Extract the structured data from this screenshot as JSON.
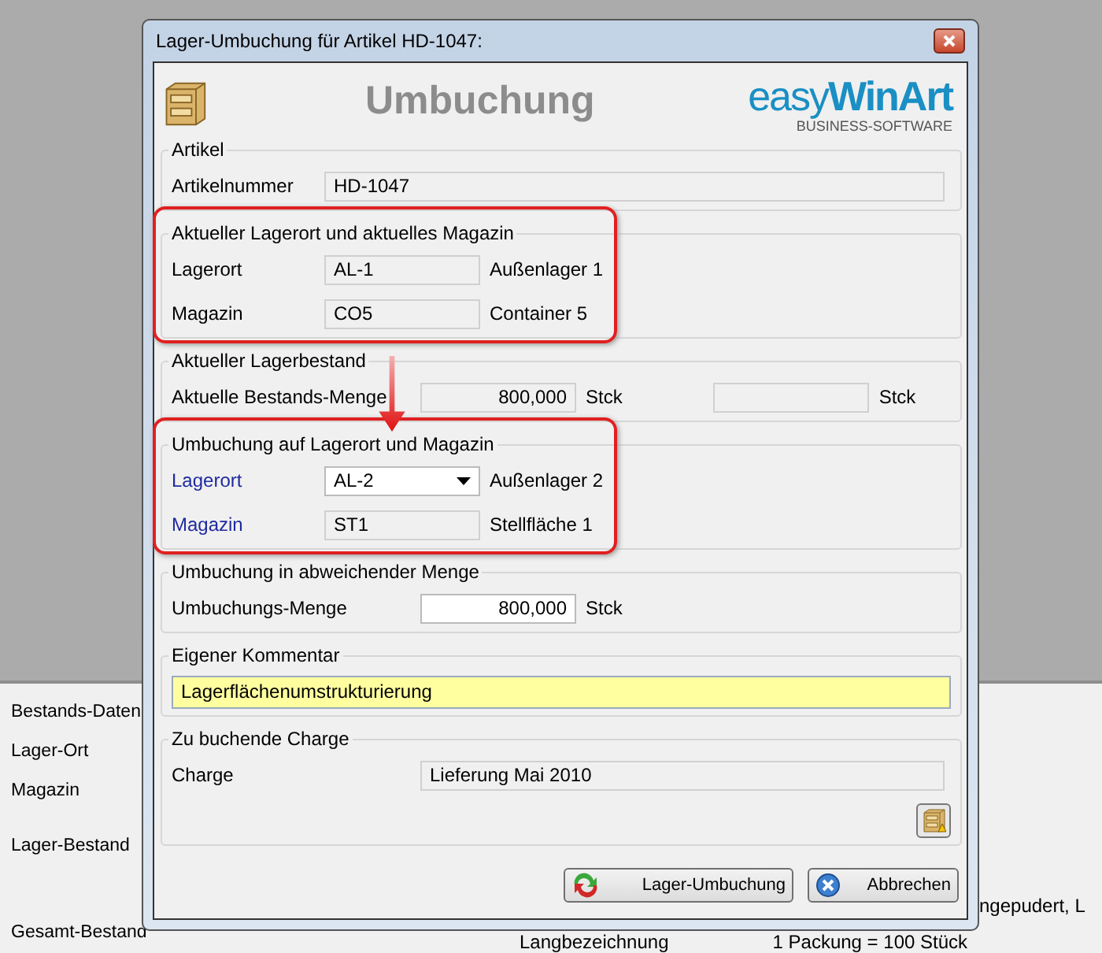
{
  "background": {
    "labels": [
      "Bestands-Daten",
      "Lager-Ort",
      "Magazin",
      "Lager-Bestand",
      "Gesamt-Bestand"
    ],
    "right_text": "ngepudert, L",
    "bottom_texts": [
      "Langbezeichnung",
      "1 Packung = 100 Stück"
    ]
  },
  "dialog": {
    "title": "Lager-Umbuchung für Artikel HD-1047:",
    "heading": "Umbuchung",
    "logo": {
      "light": "easy",
      "bold": "WinArt",
      "sub": "BUSINESS-SOFTWARE"
    },
    "annotation_arrow": true,
    "sections": [
      {
        "title": "Artikel",
        "highlighted": false,
        "rows": [
          {
            "kind": "wide",
            "label": "Artikelnummer",
            "emphasized": false,
            "value": "HD-1047",
            "readonly": true
          }
        ]
      },
      {
        "title": "Aktueller Lagerort und aktuelles Magazin",
        "highlighted": true,
        "rows": [
          {
            "kind": "location",
            "label": "Lagerort",
            "emphasized": false,
            "value": "AL-1",
            "readonly": true,
            "dropdown": false,
            "note": "Außenlager 1"
          },
          {
            "kind": "location",
            "label": "Magazin",
            "emphasized": false,
            "value": "CO5",
            "readonly": true,
            "dropdown": false,
            "note": "Container 5"
          }
        ]
      },
      {
        "title": "Aktueller Lagerbestand",
        "highlighted": false,
        "rows": [
          {
            "kind": "quantity",
            "label": "Aktuelle Bestands-Menge",
            "emphasized": false,
            "value": "800,000",
            "readonly": true,
            "unit": "Stck",
            "second_unit": "Stck"
          }
        ]
      },
      {
        "title": "Umbuchung auf Lagerort und Magazin",
        "highlighted": true,
        "rows": [
          {
            "kind": "location",
            "label": "Lagerort",
            "emphasized": true,
            "value": "AL-2",
            "readonly": false,
            "dropdown": true,
            "note": "Außenlager 2"
          },
          {
            "kind": "location",
            "label": "Magazin",
            "emphasized": true,
            "value": "ST1",
            "readonly": true,
            "dropdown": false,
            "note": "Stellfläche 1"
          }
        ]
      },
      {
        "title": "Umbuchung in abweichender Menge",
        "highlighted": false,
        "rows": [
          {
            "kind": "quantity",
            "label": "Umbuchungs-Menge",
            "emphasized": false,
            "value": "800,000",
            "readonly": false,
            "unit": "Stck"
          }
        ]
      },
      {
        "title": "Eigener Kommentar",
        "highlighted": false,
        "rows": [
          {
            "kind": "comment",
            "value": "Lagerflächenumstrukturierung",
            "readonly": false
          }
        ]
      },
      {
        "title": "Zu buchende Charge",
        "highlighted": false,
        "rows": [
          {
            "kind": "charge",
            "label": "Charge",
            "emphasized": false,
            "value": "Lieferung Mai 2010",
            "readonly": true
          }
        ],
        "tool_button": true
      }
    ],
    "buttons": [
      {
        "kind": "confirm",
        "label": "Lager-Umbuchung"
      },
      {
        "kind": "cancel",
        "label": "Abbrechen"
      }
    ]
  }
}
